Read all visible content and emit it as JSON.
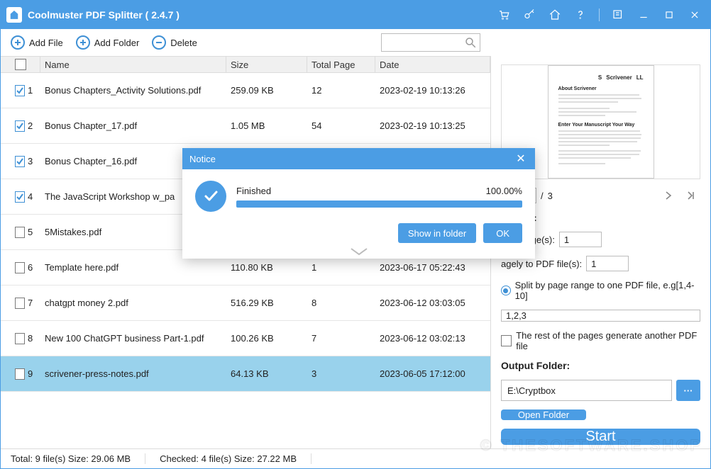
{
  "title": "Coolmuster PDF Splitter  ( 2.4.7 )",
  "toolbar": {
    "add_file": "Add File",
    "add_folder": "Add Folder",
    "delete": "Delete",
    "search_placeholder": ""
  },
  "columns": {
    "name": "Name",
    "size": "Size",
    "total": "Total Page",
    "date": "Date"
  },
  "rows": [
    {
      "idx": "1",
      "checked": true,
      "selected": false,
      "name": "Bonus Chapters_Activity Solutions.pdf",
      "size": "259.09 KB",
      "total": "12",
      "date": "2023-02-19 10:13:26"
    },
    {
      "idx": "2",
      "checked": true,
      "selected": false,
      "name": "Bonus Chapter_17.pdf",
      "size": "1.05 MB",
      "total": "54",
      "date": "2023-02-19 10:13:25"
    },
    {
      "idx": "3",
      "checked": true,
      "selected": false,
      "name": "Bonus Chapter_16.pdf",
      "size": "",
      "total": "",
      "date": ""
    },
    {
      "idx": "4",
      "checked": true,
      "selected": false,
      "name": "The JavaScript Workshop w_pa",
      "size": "",
      "total": "",
      "date": ""
    },
    {
      "idx": "5",
      "checked": false,
      "selected": false,
      "name": "5Mistakes.pdf",
      "size": "",
      "total": "",
      "date": ""
    },
    {
      "idx": "6",
      "checked": false,
      "selected": false,
      "name": "Template here.pdf",
      "size": "110.80 KB",
      "total": "1",
      "date": "2023-06-17 05:22:43"
    },
    {
      "idx": "7",
      "checked": false,
      "selected": false,
      "name": "chatgpt money 2.pdf",
      "size": "516.29 KB",
      "total": "8",
      "date": "2023-06-12 03:03:05"
    },
    {
      "idx": "8",
      "checked": false,
      "selected": false,
      "name": "New 100 ChatGPT business Part-1.pdf",
      "size": "100.26 KB",
      "total": "7",
      "date": "2023-06-12 03:02:13"
    },
    {
      "idx": "9",
      "checked": false,
      "selected": true,
      "name": "scrivener-press-notes.pdf",
      "size": "64.13 KB",
      "total": "3",
      "date": "2023-06-05 17:12:00"
    }
  ],
  "preview": {
    "page": "1",
    "total": "3",
    "doc_title": "Scrivener",
    "heading": "About Scrivener",
    "heading2": "Enter Your Manuscript Your Way"
  },
  "split": {
    "title": "Method:",
    "opt1": "very page(s):",
    "opt1_val": "1",
    "opt2": "agely to PDF file(s):",
    "opt2_val": "1",
    "opt3": "Split by page range to one PDF file, e.g[1,4-10]",
    "range_val": "1,2,3",
    "rest": "The rest of the pages generate another PDF file"
  },
  "output": {
    "title": "Output Folder:",
    "path": "E:\\Cryptbox",
    "open": "Open Folder"
  },
  "start": "Start",
  "status": {
    "total": "Total: 9 file(s) Size: 29.06 MB",
    "checked": "Checked: 4 file(s) Size: 27.22 MB"
  },
  "dialog": {
    "title": "Notice",
    "status": "Finished",
    "percent": "100.00%",
    "show": "Show in folder",
    "ok": "OK"
  },
  "watermark": "© THESOFTWARE.SHOP"
}
